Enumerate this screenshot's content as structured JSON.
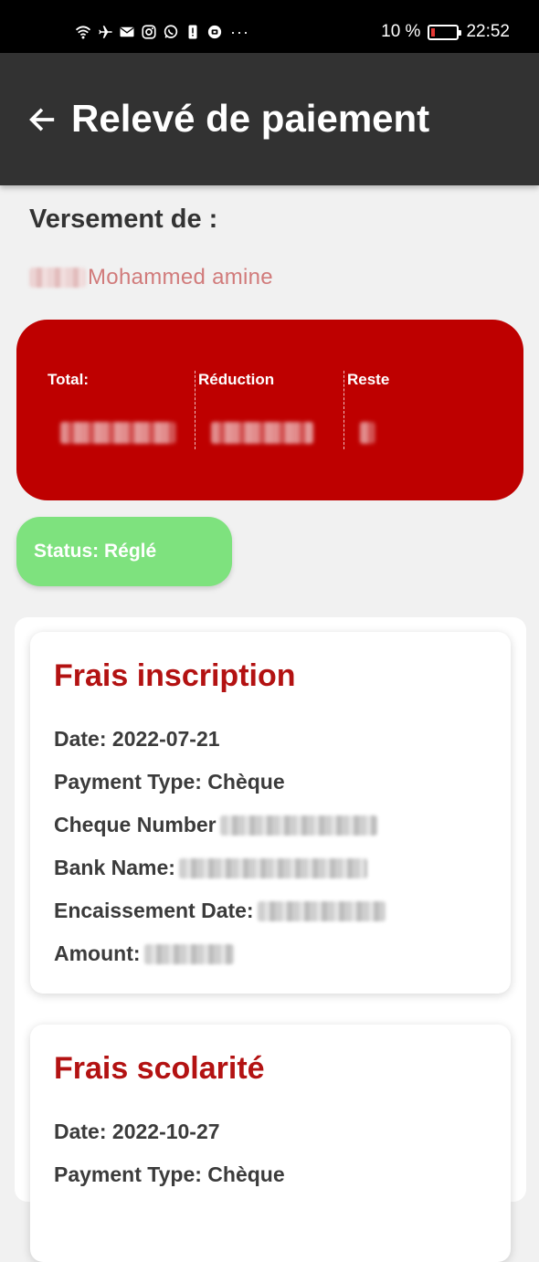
{
  "status_bar": {
    "icons": [
      "wifi-icon",
      "airplane-icon",
      "mail-icon",
      "instagram-icon",
      "whatsapp-icon",
      "alert-icon",
      "app-icon"
    ],
    "more": "···",
    "battery": "10 %",
    "battery_level_percent": 10,
    "time": "22:52"
  },
  "app_bar": {
    "title": "Relevé de paiement",
    "back_icon": "arrow-left-icon"
  },
  "header": {
    "versement_label": "Versement de :",
    "payer_name": "Mohammed amine"
  },
  "summary": {
    "total_label": "Total:",
    "reduction_label": "Réduction",
    "reste_label": "Reste"
  },
  "status": {
    "text": "Status: Réglé"
  },
  "payments": [
    {
      "title": "Frais inscription",
      "date": "Date: 2022-07-21",
      "payment_type": "Payment Type: Chèque",
      "cheque_label": "Cheque Number",
      "bank_label": "Bank Name:",
      "encaissement_label": "Encaissement Date:",
      "amount_label": "Amount:"
    },
    {
      "title": "Frais scolarité",
      "date": "Date: 2022-10-27",
      "payment_type": "Payment Type: Chèque"
    }
  ],
  "colors": {
    "app_bar": "#323232",
    "summary_card": "#be0000",
    "status_chip": "#7ee27e",
    "card_title": "#b31212",
    "payer_name": "#d17b7b"
  }
}
